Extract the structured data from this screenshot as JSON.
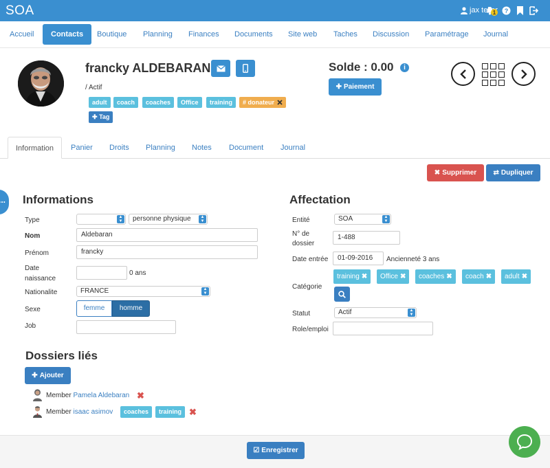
{
  "app": {
    "title": "SOA",
    "user": "jax teller",
    "notif_count": "1"
  },
  "nav": {
    "items": [
      "Accueil",
      "Contacts",
      "Boutique",
      "Planning",
      "Finances",
      "Documents",
      "Site web",
      "Taches",
      "Discussion",
      "Paramétrage",
      "Journal"
    ],
    "active": "Contacts"
  },
  "contact": {
    "name": "francky ALDEBARAN",
    "status": "/ Actif",
    "tags": [
      "adult",
      "coach",
      "coaches",
      "Office",
      "training"
    ],
    "special_tag": "# donateur",
    "tag_button": "Tag",
    "solde": "Solde : 0.00",
    "paiement_button": "Paiement",
    "prev_label": "<",
    "next_label": ">"
  },
  "tabs": {
    "items": [
      "Information",
      "Panier",
      "Droits",
      "Planning",
      "Notes",
      "Document",
      "Journal"
    ],
    "active": "Information"
  },
  "actions": {
    "supprimer": "Supprimer",
    "dupliquer": "Dupliquer"
  },
  "side_handle": "...",
  "informations": {
    "title": "Informations",
    "type_label": "Type",
    "type_value": "",
    "type_value2": "personne physique",
    "nom_label": "Nom",
    "nom_value": "Aldebaran",
    "prenom_label": "Prénom",
    "prenom_value": "francky",
    "date_label_1": "Date",
    "date_label_2": "naissance",
    "date_value": "",
    "age": "0 ans",
    "nationalite_label": "Nationalite",
    "nationalite_value": "FRANCE",
    "sexe_label": "Sexe",
    "sexe_options": [
      "femme",
      "homme"
    ],
    "sexe_selected": "homme",
    "job_label": "Job",
    "job_value": ""
  },
  "affectation": {
    "title": "Affectation",
    "entite_label": "Entité",
    "entite_value": "SOA",
    "dossier_label_1": "N° de",
    "dossier_label_2": "dossier",
    "dossier_value": "1-488",
    "date_entree_label": "Date entrée",
    "date_entree_value": "01-09-2016",
    "anciennete": "Ancienneté 3 ans",
    "categorie_label": "Catégorie",
    "categories": [
      "training",
      "Office",
      "coaches",
      "coach",
      "adult"
    ],
    "statut_label": "Statut",
    "statut_value": "Actif",
    "role_label": "Role/emploi",
    "role_value": ""
  },
  "dossiers": {
    "title": "Dossiers liés",
    "add_button": "Ajouter",
    "members": [
      {
        "prefix": "Member",
        "name": "Pamela Aldebaran",
        "tags": []
      },
      {
        "prefix": "Member",
        "name": "isaac asimov",
        "tags": [
          "coaches",
          "training"
        ]
      }
    ]
  },
  "footer": {
    "save_button": "Enregistrer"
  },
  "colors": {
    "primary": "#3a8fd0",
    "info": "#5bc0de",
    "warning": "#f0ad4e",
    "danger": "#d9534f",
    "chat": "#4caf50"
  }
}
